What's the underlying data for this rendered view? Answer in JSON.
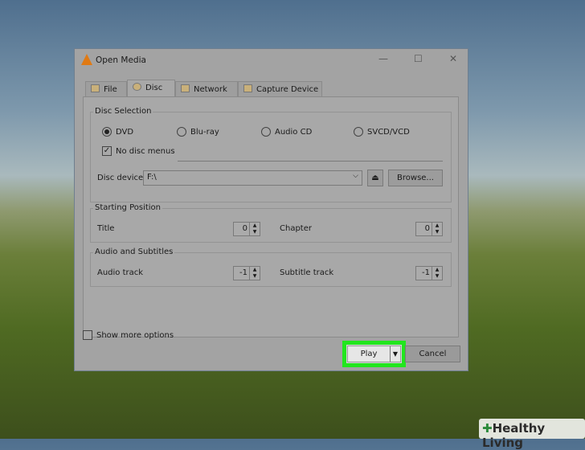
{
  "window": {
    "title": "Open Media",
    "minimize": "—",
    "maximize": "☐",
    "close": "✕"
  },
  "tabs": [
    {
      "label": "File"
    },
    {
      "label": "Disc"
    },
    {
      "label": "Network"
    },
    {
      "label": "Capture Device"
    }
  ],
  "disc_selection": {
    "label": "Disc Selection",
    "options": [
      "DVD",
      "Blu-ray",
      "Audio CD",
      "SVCD/VCD"
    ],
    "selected": "DVD",
    "no_disc_menus": {
      "label": "No disc menus",
      "checked": true
    },
    "device_label": "Disc device",
    "device_value": "F:\\",
    "eject": "⏏",
    "browse": "Browse..."
  },
  "starting_position": {
    "label": "Starting Position",
    "title_label": "Title",
    "title_value": "0",
    "chapter_label": "Chapter",
    "chapter_value": "0"
  },
  "audio_subtitles": {
    "label": "Audio and Subtitles",
    "audio_label": "Audio track",
    "audio_value": "-1",
    "subtitle_label": "Subtitle track",
    "subtitle_value": "-1"
  },
  "show_more": {
    "label": "Show more options",
    "checked": false
  },
  "buttons": {
    "play": "Play",
    "cancel": "Cancel"
  },
  "highlight_color": "#22e61e",
  "watermark": "Healthy Living"
}
